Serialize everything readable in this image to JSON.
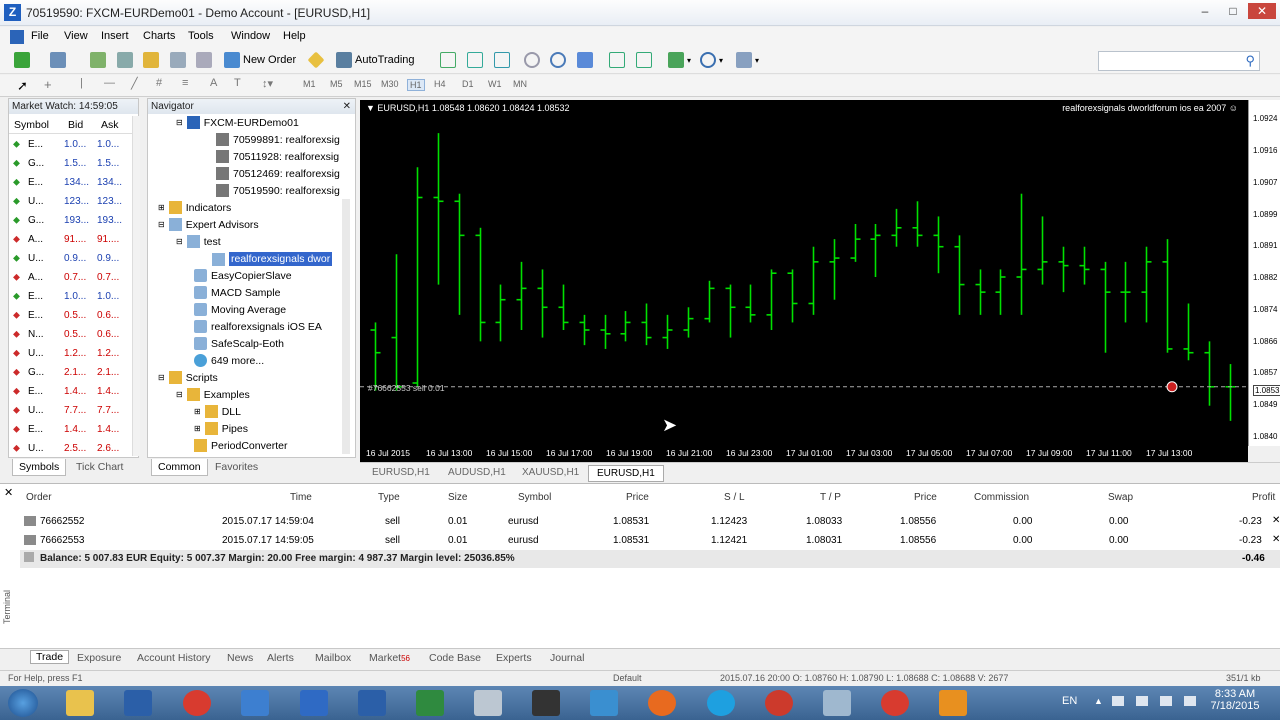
{
  "window": {
    "title": "70519590: FXCM-EURDemo01 - Demo Account - [EURUSD,H1]"
  },
  "menu": [
    "File",
    "Insert",
    "Charts",
    "Tools",
    "Window",
    "Help"
  ],
  "view_menu": "View",
  "toolbar": {
    "new_order": "New Order",
    "autotrading": "AutoTrading"
  },
  "timeframes": [
    "M1",
    "M5",
    "M15",
    "M30",
    "H1",
    "H4",
    "D1",
    "W1",
    "MN"
  ],
  "market_watch": {
    "title": "Market Watch: 14:59:05",
    "headers": [
      "Symbol",
      "Bid",
      "Ask"
    ],
    "rows": [
      {
        "s": "E...",
        "b": "1.0...",
        "a": "1.0...",
        "up": true
      },
      {
        "s": "G...",
        "b": "1.5...",
        "a": "1.5...",
        "up": true
      },
      {
        "s": "E...",
        "b": "134...",
        "a": "134...",
        "up": true
      },
      {
        "s": "U...",
        "b": "123...",
        "a": "123...",
        "up": true
      },
      {
        "s": "G...",
        "b": "193...",
        "a": "193...",
        "up": true
      },
      {
        "s": "A...",
        "b": "91....",
        "a": "91....",
        "up": false
      },
      {
        "s": "U...",
        "b": "0.9...",
        "a": "0.9...",
        "up": true
      },
      {
        "s": "A...",
        "b": "0.7...",
        "a": "0.7...",
        "up": false
      },
      {
        "s": "E...",
        "b": "1.0...",
        "a": "1.0...",
        "up": true
      },
      {
        "s": "E...",
        "b": "0.5...",
        "a": "0.6...",
        "up": false
      },
      {
        "s": "N...",
        "b": "0.5...",
        "a": "0.6...",
        "up": false
      },
      {
        "s": "U...",
        "b": "1.2...",
        "a": "1.2...",
        "up": false
      },
      {
        "s": "G...",
        "b": "2.1...",
        "a": "2.1...",
        "up": false
      },
      {
        "s": "E...",
        "b": "1.4...",
        "a": "1.4...",
        "up": false
      },
      {
        "s": "U...",
        "b": "7.7...",
        "a": "7.7...",
        "up": false
      },
      {
        "s": "E...",
        "b": "1.4...",
        "a": "1.4...",
        "up": false
      },
      {
        "s": "U...",
        "b": "2.5...",
        "a": "2.6...",
        "up": false
      }
    ],
    "tabs": [
      "Symbols",
      "Tick Chart"
    ]
  },
  "navigator": {
    "title": "Navigator",
    "account_root": "FXCM-EURDemo01",
    "accounts": [
      "70599891: realforexsig",
      "70511928: realforexsig",
      "70512469: realforexsig",
      "70519590: realforexsig"
    ],
    "indicators": "Indicators",
    "experts": "Expert Advisors",
    "test": "test",
    "selected": "realforexsignals dwor",
    "eas": [
      "EasyCopierSlave",
      "MACD Sample",
      "Moving Average",
      "realforexsignals iOS EA",
      "SafeScalp-Eoth",
      "649 more..."
    ],
    "scripts": "Scripts",
    "examples": "Examples",
    "dll": "DLL",
    "pipes": "Pipes",
    "period": "PeriodConverter",
    "tabs": [
      "Common",
      "Favorites"
    ]
  },
  "chart": {
    "header": "EURUSD,H1  1.08548 1.08620 1.08424 1.08532",
    "ea_label": "realforexsignals dworldforum ios ea 2007",
    "order_label": "#76662553 sell 0.01",
    "line_color": "#00e000",
    "price_labels": [
      "1.0924",
      "1.0916",
      "1.0907",
      "1.0899",
      "1.0891",
      "1.0882",
      "1.0874",
      "1.0866",
      "1.0857",
      "1.0853",
      "1.0849",
      "1.0840"
    ],
    "time_labels": [
      "16 Jul 2015",
      "16 Jul 13:00",
      "16 Jul 15:00",
      "16 Jul 17:00",
      "16 Jul 19:00",
      "16 Jul 21:00",
      "16 Jul 23:00",
      "17 Jul 01:00",
      "17 Jul 03:00",
      "17 Jul 05:00",
      "17 Jul 07:00",
      "17 Jul 09:00",
      "17 Jul 11:00",
      "17 Jul 13:00"
    ],
    "tabs": [
      "EURUSD,H1",
      "AUDUSD,H1",
      "XAUUSD,H1",
      "EURUSD,H1"
    ]
  },
  "terminal": {
    "headers": [
      "Order",
      "Time",
      "Type",
      "Size",
      "Symbol",
      "Price",
      "S / L",
      "T / P",
      "Price",
      "Commission",
      "Swap",
      "Profit"
    ],
    "rows": [
      [
        "76662552",
        "2015.07.17 14:59:04",
        "sell",
        "0.01",
        "eurusd",
        "1.08531",
        "1.12423",
        "1.08033",
        "1.08556",
        "0.00",
        "0.00",
        "-0.23"
      ],
      [
        "76662553",
        "2015.07.17 14:59:05",
        "sell",
        "0.01",
        "eurusd",
        "1.08531",
        "1.12421",
        "1.08031",
        "1.08556",
        "0.00",
        "0.00",
        "-0.23"
      ]
    ],
    "balance": "Balance: 5 007.83 EUR  Equity: 5 007.37  Margin: 20.00  Free margin: 4 987.37  Margin level: 25036.85%",
    "total": "-0.46",
    "side_label": "Terminal",
    "tabs": [
      "Trade",
      "Exposure",
      "Account History",
      "News",
      "Alerts",
      "Mailbox",
      "Market",
      "Code Base",
      "Experts",
      "Journal"
    ],
    "market_badge": "56"
  },
  "status": {
    "help": "For Help, press F1",
    "profile": "Default",
    "tick": "2015.07.16 20:00   O: 1.08760   H: 1.08790   L: 1.08688   C: 1.08688   V: 2677",
    "conn": "351/1 kb"
  },
  "taskbar": {
    "lang": "EN",
    "time": "8:33 AM",
    "date": "7/18/2015"
  }
}
